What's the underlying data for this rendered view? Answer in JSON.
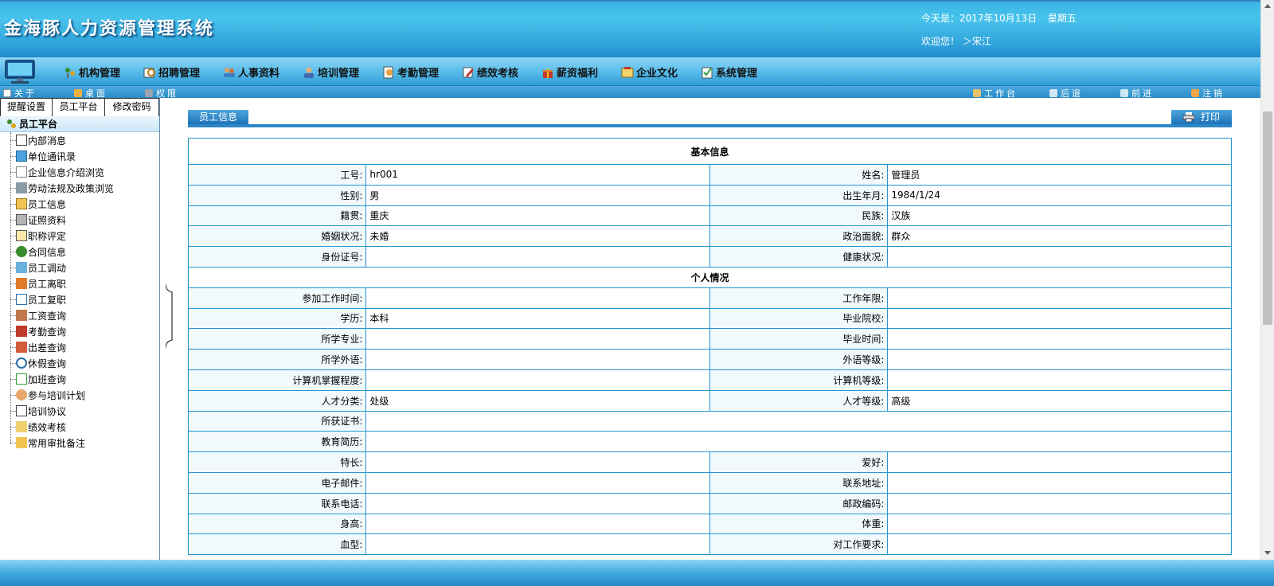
{
  "header": {
    "app_title": "金海豚人力资源管理系统",
    "date_prefix": "今天是：2017年10月13日",
    "weekday": "星期五",
    "welcome": "欢迎您！ ＞宋江"
  },
  "nav": {
    "items": [
      {
        "label": "机构管理",
        "icon": "org-icon"
      },
      {
        "label": "招聘管理",
        "icon": "recruit-icon"
      },
      {
        "label": "人事资料",
        "icon": "people-icon"
      },
      {
        "label": "培训管理",
        "icon": "training-icon"
      },
      {
        "label": "考勤管理",
        "icon": "attendance-icon"
      },
      {
        "label": "绩效考核",
        "icon": "pencil-icon"
      },
      {
        "label": "薪资福利",
        "icon": "gift-icon"
      },
      {
        "label": "企业文化",
        "icon": "culture-icon"
      },
      {
        "label": "系统管理",
        "icon": "checklist-icon"
      }
    ]
  },
  "toolbar": {
    "about": "关于",
    "desktop": "桌面",
    "permission": "权限",
    "workbench": "工作台",
    "back": "后退",
    "forward": "前进",
    "logout": "注销"
  },
  "sidebar": {
    "tabs": [
      "提醒设置",
      "员工平台",
      "修改密码"
    ],
    "root": "员工平台",
    "items": [
      "内部消息",
      "单位通讯录",
      "企业信息介绍浏览",
      "劳动法规及政策浏览",
      "员工信息",
      "证照资料",
      "职称评定",
      "合同信息",
      "员工调动",
      "员工离职",
      "员工复职",
      "工资查询",
      "考勤查询",
      "出差查询",
      "休假查询",
      "加班查询",
      "参与培训计划",
      "培训协议",
      "绩效考核",
      "常用审批备注"
    ]
  },
  "main": {
    "section_tab": "员工信息",
    "print_label": "打印",
    "basic_title": "基本信息",
    "personal_title": "个人情况",
    "fields": {
      "emp_no_label": "工号:",
      "emp_no": "hr001",
      "name_label": "姓名:",
      "name": "管理员",
      "gender_label": "性别:",
      "gender": "男",
      "birth_label": "出生年月:",
      "birth": "1984/1/24",
      "native_label": "籍贯:",
      "native": "重庆",
      "ethnic_label": "民族:",
      "ethnic": "汉族",
      "marital_label": "婚姻状况:",
      "marital": "未婚",
      "political_label": "政治面貌:",
      "political": "群众",
      "idcard_label": "身份证号:",
      "idcard": "",
      "health_label": "健康状况:",
      "health": "",
      "workstart_label": "参加工作时间:",
      "workstart": "",
      "workyears_label": "工作年限:",
      "workyears": "",
      "edu_label": "学历:",
      "edu": "本科",
      "school_label": "毕业院校:",
      "school": "",
      "major_label": "所学专业:",
      "major": "",
      "gradtime_label": "毕业时间:",
      "gradtime": "",
      "lang_label": "所学外语:",
      "lang": "",
      "langlevel_label": "外语等级:",
      "langlevel": "",
      "computer_label": "计算机掌握程度:",
      "computer": "",
      "complevel_label": "计算机等级:",
      "complevel": "",
      "talent_label": "人才分类:",
      "talent": "处级",
      "talentlevel_label": "人才等级:",
      "talentlevel": "高级",
      "cert_label": "所获证书:",
      "cert": "",
      "eduhist_label": "教育简历:",
      "eduhist": "",
      "specialty_label": "特长:",
      "specialty": "",
      "hobby_label": "爱好:",
      "hobby": "",
      "email_label": "电子邮件:",
      "email": "",
      "address_label": "联系地址:",
      "address": "",
      "phone_label": "联系电话:",
      "phone": "",
      "zip_label": "邮政编码:",
      "zip": "",
      "height_label": "身高:",
      "height": "",
      "weight_label": "体重:",
      "weight": "",
      "blood_label": "血型:",
      "blood": "",
      "jobreq_label": "对工作要求:",
      "jobreq": ""
    }
  }
}
